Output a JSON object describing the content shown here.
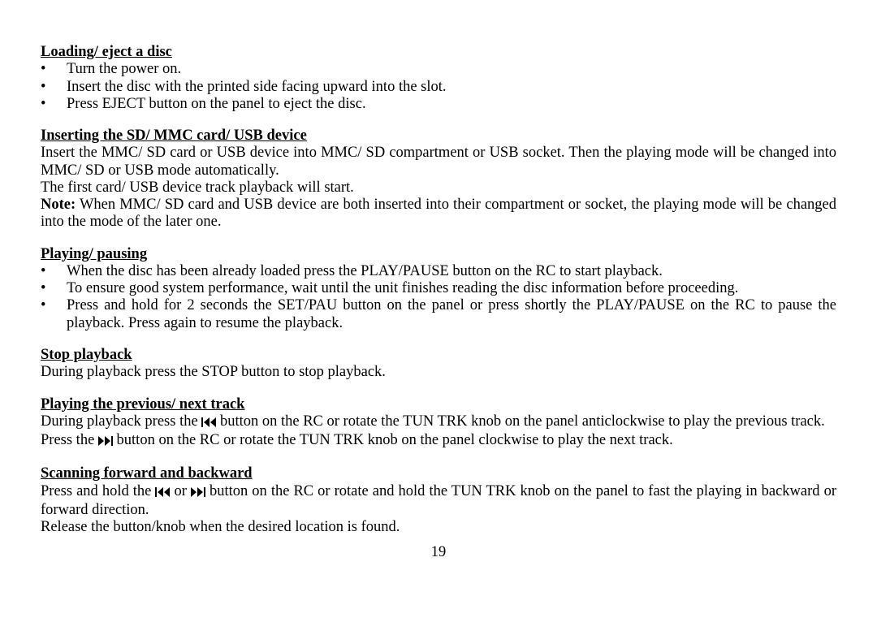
{
  "sections": {
    "loading": {
      "heading": "Loading/ eject a disc",
      "items": [
        "Turn the power on.",
        "Insert the disc with the printed side facing upward into the slot.",
        "Press EJECT button on the panel to eject the disc."
      ]
    },
    "inserting": {
      "heading": "Inserting the SD/ MMC card/ USB device",
      "p1": "Insert the MMC/ SD card or USB device into MMC/ SD compartment or USB socket. Then the playing mode will be changed into MMC/ SD or USB mode automatically.",
      "p2": "The first card/ USB device track playback will start.",
      "note_label": "Note:",
      "note_body": " When MMC/ SD card and USB device are both inserted into their compartment or socket, the playing mode will be changed into the mode of the later one."
    },
    "playing": {
      "heading": "Playing/ pausing",
      "items": [
        "When the disc has been already loaded press the PLAY/PAUSE button on the RC to start playback.",
        "To ensure good system performance, wait until the unit finishes reading the disc information before proceeding.",
        "Press and hold for 2 seconds the SET/PAU button on the panel or press shortly the PLAY/PAUSE on the RC to pause the playback. Press again to resume the playback."
      ]
    },
    "stop": {
      "heading": "Stop playback",
      "p1": "During playback press the STOP button to stop playback."
    },
    "prevnext": {
      "heading": "Playing the previous/ next track",
      "p1_a": "During playback press the ",
      "p1_b": " button on the RC or rotate the TUN TRK knob on the panel anticlockwise to play the previous track.",
      "p2_a": "Press the ",
      "p2_b": " button on the RC or rotate the TUN TRK knob on the panel clockwise to play the next track."
    },
    "scanning": {
      "heading": "Scanning forward and backward",
      "p1_a": "Press and hold the ",
      "p1_mid": " or ",
      "p1_b": " button on the RC or rotate and hold the TUN TRK knob on the panel to fast the playing in backward or forward direction.",
      "p2": "Release the button/knob when the desired location is found."
    }
  },
  "page_number": "19",
  "icons": {
    "prev": "prev-track-icon",
    "next": "next-track-icon"
  }
}
